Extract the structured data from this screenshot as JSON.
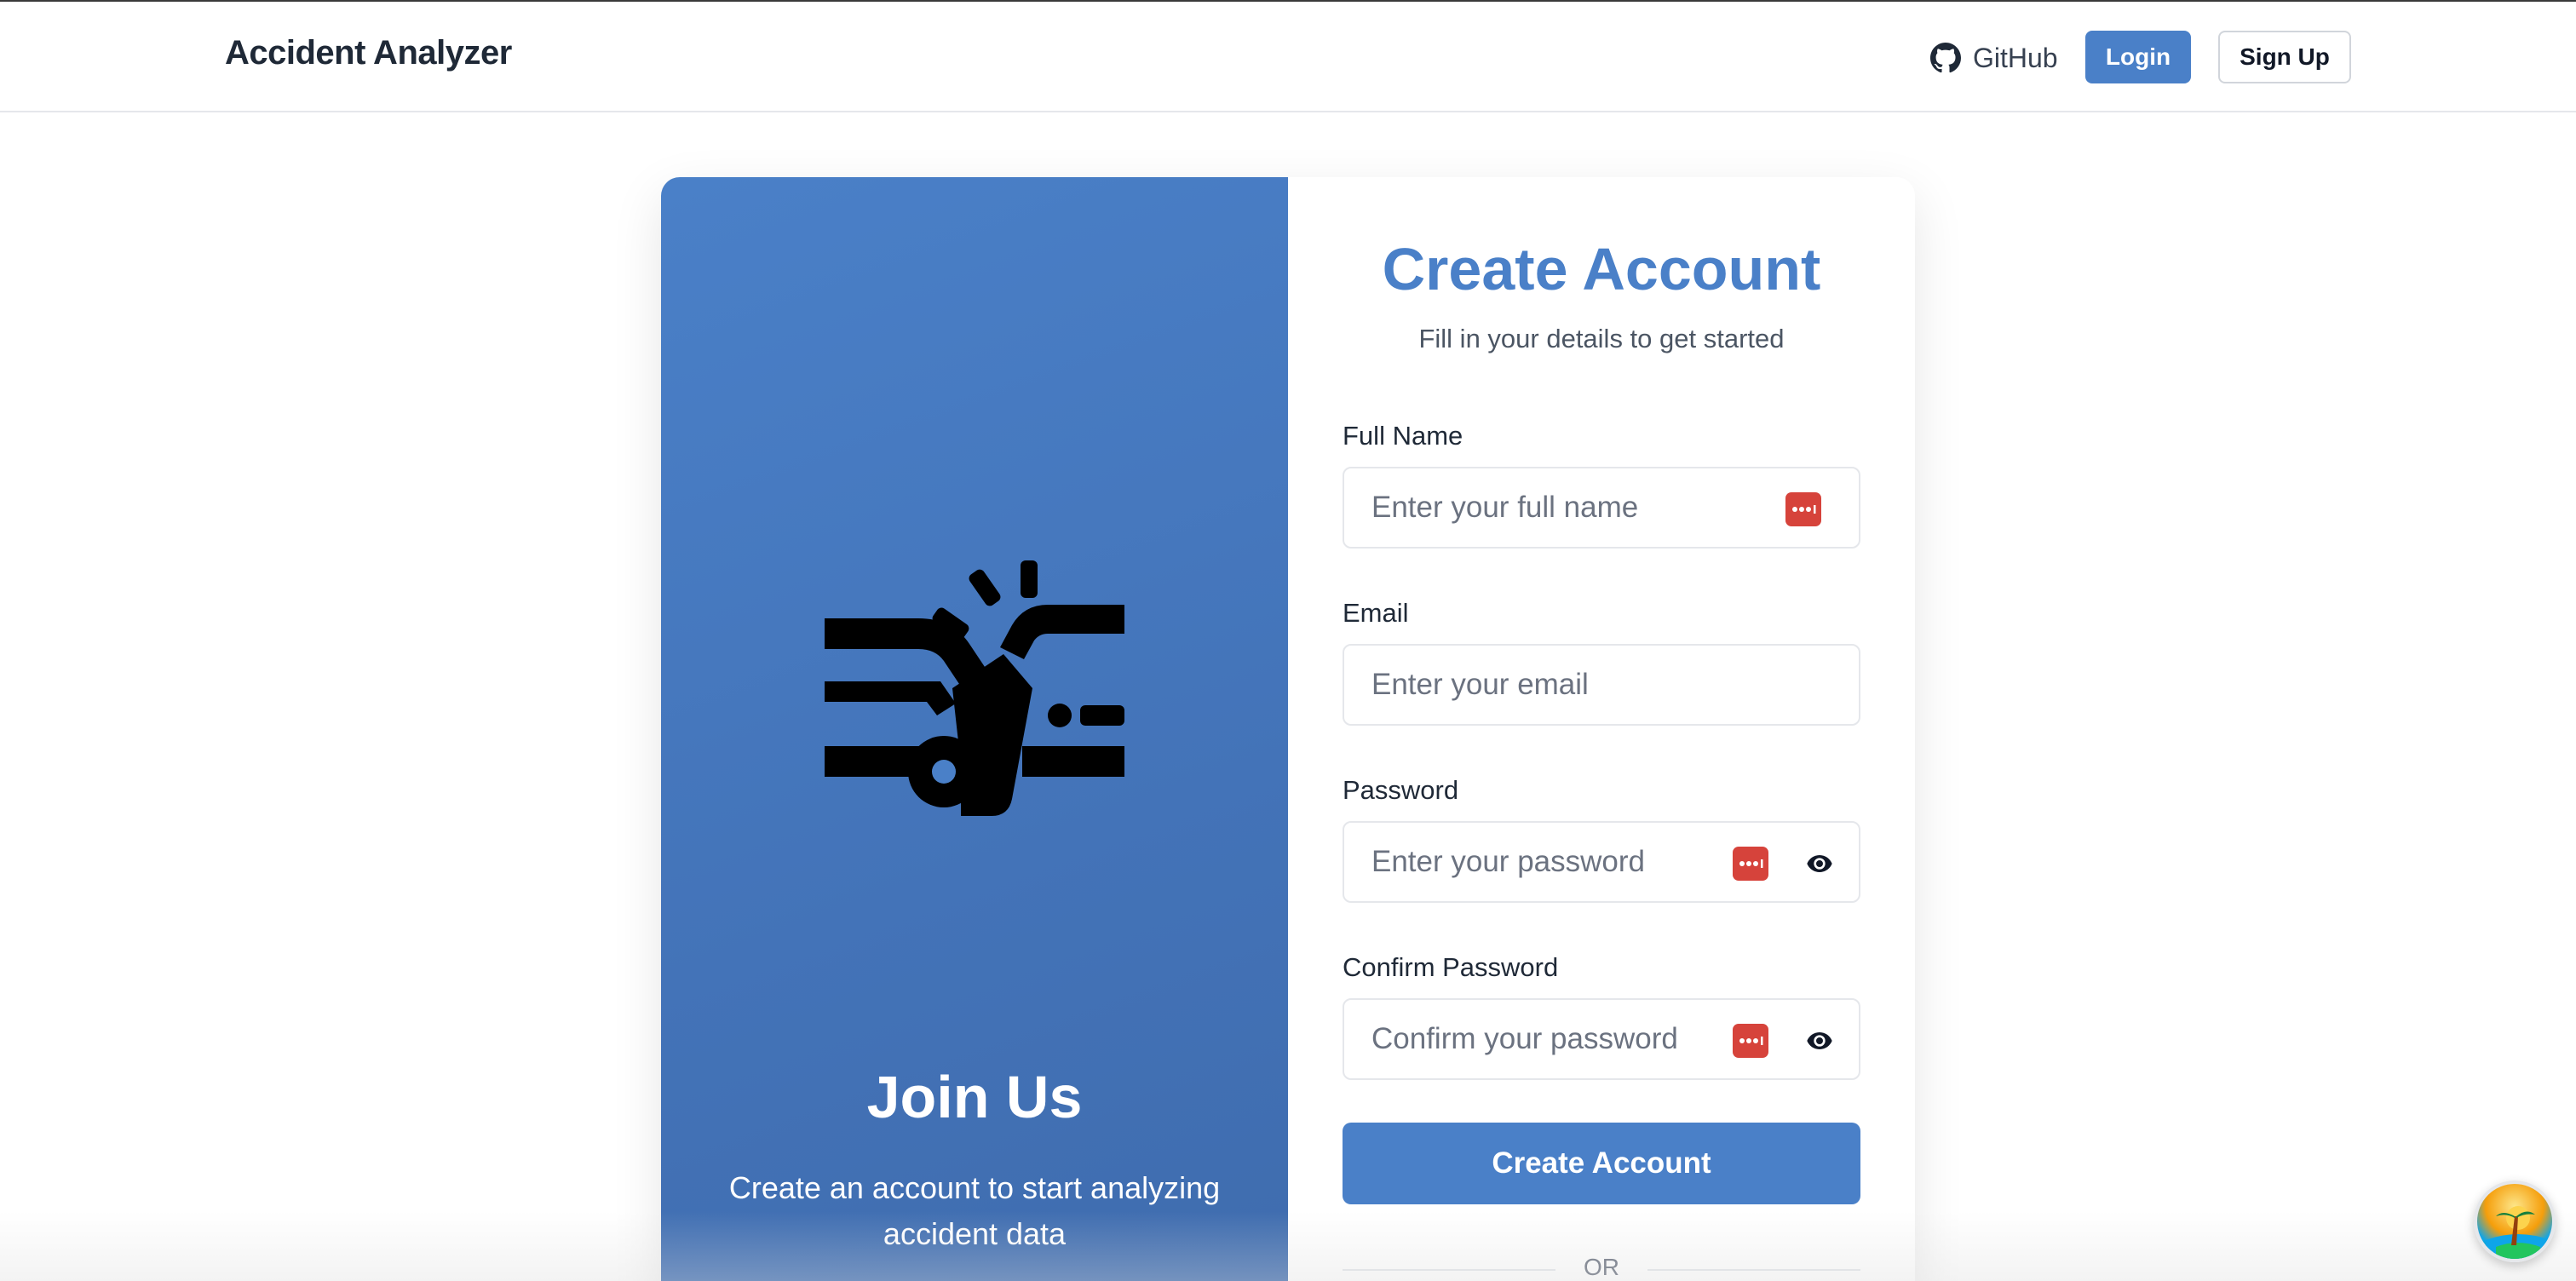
{
  "navbar": {
    "brand": "Accident Analyzer",
    "github_label": "GitHub",
    "login_label": "Login",
    "signup_label": "Sign Up"
  },
  "left_panel": {
    "icon": "car-crash-icon",
    "title": "Join Us",
    "subtitle": "Create an account to start analyzing accident data"
  },
  "form": {
    "title": "Create Account",
    "subtitle": "Fill in your details to get started",
    "fields": [
      {
        "label": "Full Name",
        "placeholder": "Enter your full name",
        "type": "text"
      },
      {
        "label": "Email",
        "placeholder": "Enter your email",
        "type": "email"
      },
      {
        "label": "Password",
        "placeholder": "Enter your password",
        "type": "password"
      },
      {
        "label": "Confirm Password",
        "placeholder": "Confirm your password",
        "type": "password"
      }
    ],
    "submit_label": "Create Account",
    "divider_text": "OR"
  },
  "colors": {
    "accent": "#4a80c8",
    "password_manager": "#d6433b"
  },
  "icons": [
    "github-icon",
    "password-manager-icon",
    "eye-icon",
    "car-crash-icon",
    "extension-badge-icon"
  ]
}
